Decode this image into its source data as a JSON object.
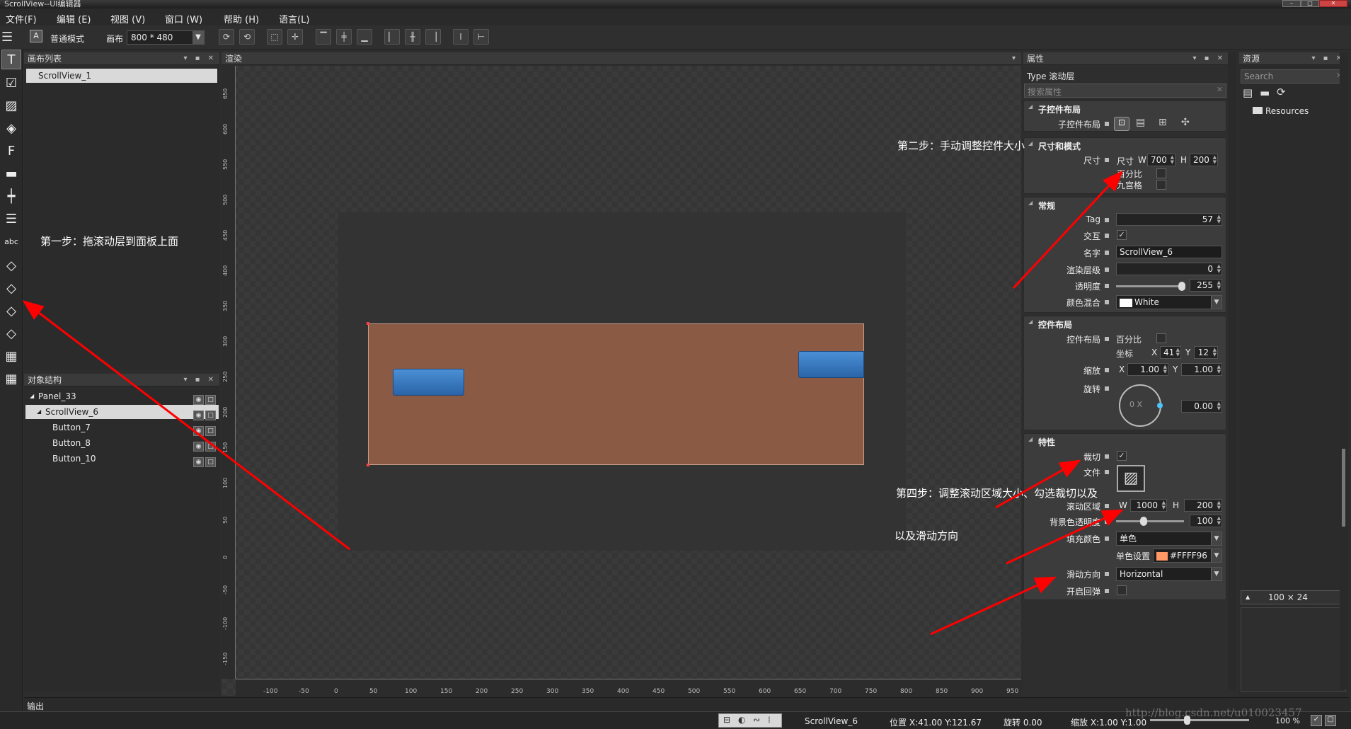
{
  "window": {
    "title": "ScrollView--UI编辑器"
  },
  "menu": [
    "文件(F)",
    "编辑 (E)",
    "视图 (V)",
    "窗口 (W)",
    "帮助 (H)",
    "语言(L)"
  ],
  "toolbar": {
    "mode_label": "普通模式",
    "canvas_label": "画布",
    "canvas_size": "800 * 480"
  },
  "canvas_list": {
    "title": "画布列表",
    "items": [
      "ScrollView_1"
    ]
  },
  "object_tree": {
    "title": "对象结构",
    "rows": [
      {
        "label": "Panel_33",
        "indent": 0,
        "expander": "◢"
      },
      {
        "label": "ScrollView_6",
        "indent": 1,
        "expander": "◢",
        "selected": true
      },
      {
        "label": "Button_7",
        "indent": 2,
        "expander": ""
      },
      {
        "label": "Button_8",
        "indent": 2,
        "expander": ""
      },
      {
        "label": "Button_10",
        "indent": 2,
        "expander": ""
      }
    ]
  },
  "render": {
    "title": "渲染",
    "ruler_h": [
      "-100",
      "-50",
      "0",
      "50",
      "100",
      "150",
      "200",
      "250",
      "300",
      "350",
      "400",
      "450",
      "500",
      "550",
      "600",
      "650",
      "700",
      "750",
      "800",
      "850",
      "900",
      "950"
    ],
    "ruler_v": [
      "650",
      "600",
      "550",
      "500",
      "450",
      "400",
      "350",
      "300",
      "250",
      "200",
      "150",
      "100",
      "50",
      "0",
      "-50",
      "-100",
      "-150"
    ]
  },
  "properties": {
    "title": "属性",
    "type_line": "Type 滚动层",
    "search_placeholder": "搜索属性",
    "child_layout": {
      "title": "子控件布局",
      "label": "子控件布局"
    },
    "size_mode": {
      "title": "尺寸和模式",
      "label": "尺寸",
      "sub": "尺寸",
      "w_label": "W",
      "w": "700",
      "h_label": "H",
      "h": "200",
      "percent": "百分比",
      "nine": "九宫格"
    },
    "general": {
      "title": "常规",
      "tag_label": "Tag",
      "tag": "57",
      "interact_label": "交互",
      "name_label": "名字",
      "name": "ScrollView_6",
      "zorder_label": "渲染层级",
      "zorder": "0",
      "opacity_label": "透明度",
      "opacity": "255",
      "blend_label": "颜色混合",
      "blend": "White"
    },
    "layout": {
      "title": "控件布局",
      "label": "控件布局",
      "percent": "百分比",
      "pos_label": "坐标",
      "x_label": "X",
      "x": "41",
      "y_label": "Y",
      "y": "12",
      "scale_label": "缩放",
      "sx": "1.00",
      "sy": "1.00",
      "rot_label": "旋转",
      "rot_dial": "0 X",
      "rot": "0.00"
    },
    "features": {
      "title": "特性",
      "clip_label": "裁切",
      "file_label": "文件",
      "scroll_area_label": "滚动区域",
      "sw_label": "W",
      "sw": "1000",
      "sh_label": "H",
      "sh": "200",
      "bg_opacity_label": "背景色透明度",
      "bg_opacity": "100",
      "fill_label": "填充颜色",
      "fill": "单色",
      "single_label": "单色设置",
      "single": "#FFFF96",
      "dir_label": "滑动方向",
      "dir": "Horizontal",
      "bounce_label": "开启回弹"
    }
  },
  "resources": {
    "title": "资源",
    "search_placeholder": "Search",
    "tree_item": "Resources",
    "size_readout": "100 × 24"
  },
  "output": {
    "title": "输出"
  },
  "status": {
    "selected": "ScrollView_6",
    "pos": "位置 X:41.00  Y:121.67",
    "rot": "旋转 0.00",
    "scale": "缩放 X:1.00  Y:1.00",
    "zoom": "100 %"
  },
  "annotations": {
    "step1": "第一步：拖滚动层到面板上面",
    "step2": "第二步：手动调整控件大小",
    "step4a": "第四步：调整滚动区域大小、勾选裁切以及",
    "step4b": "以及滑动方向"
  },
  "watermark": "http://blog.csdn.net/u010023457",
  "colors": {
    "scrollview": "#8b5a45",
    "button": "#2f6fb4",
    "single_color_swatch": "#ff9966",
    "arrow": "#ff0000"
  }
}
